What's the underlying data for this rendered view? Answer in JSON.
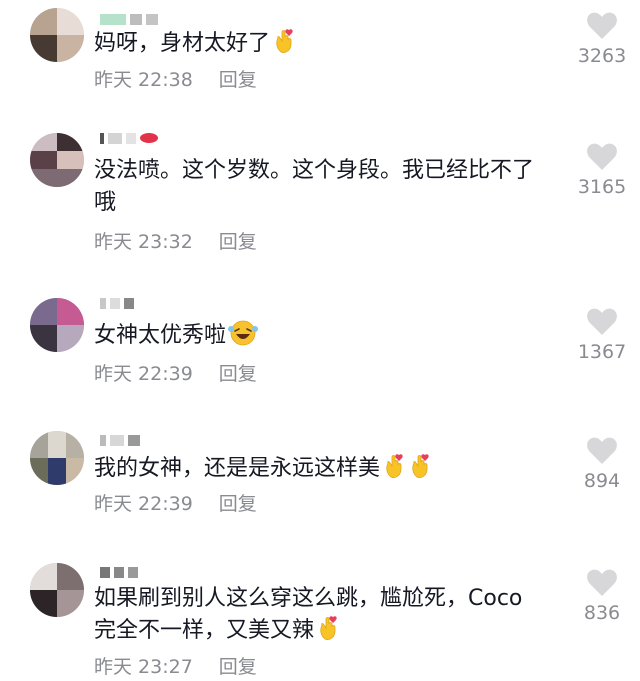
{
  "comments": [
    {
      "text": "妈呀，身材太好了",
      "emojis": [
        "finger-heart"
      ],
      "time": "昨天 22:38",
      "reply": "回复",
      "likes": "3263"
    },
    {
      "text": "没法喷。这个岁数。这个身段。我已经比不了\n哦",
      "emojis": [],
      "time": "昨天 23:32",
      "reply": "回复",
      "likes": "3165"
    },
    {
      "text": "女神太优秀啦",
      "emojis": [
        "laughing-wink"
      ],
      "time": "昨天 22:39",
      "reply": "回复",
      "likes": "1367"
    },
    {
      "text": "我的女神，还是是永远这样美",
      "emojis": [
        "finger-heart",
        "finger-heart"
      ],
      "time": "昨天 22:39",
      "reply": "回复",
      "likes": "894"
    },
    {
      "text": "如果刷到别人这么穿这么跳，尴尬死，Coco\n完全不一样，又美又辣",
      "emojis": [
        "finger-heart"
      ],
      "time": "昨天 23:27",
      "reply": "回复",
      "likes": "836"
    }
  ],
  "colors": {
    "text": "#161823",
    "meta": "#8a8b91",
    "heart": "#d7d7da"
  },
  "icons": {
    "like": "heart-icon",
    "finger_heart": "finger-heart-emoji",
    "laugh": "laughing-emoji"
  }
}
